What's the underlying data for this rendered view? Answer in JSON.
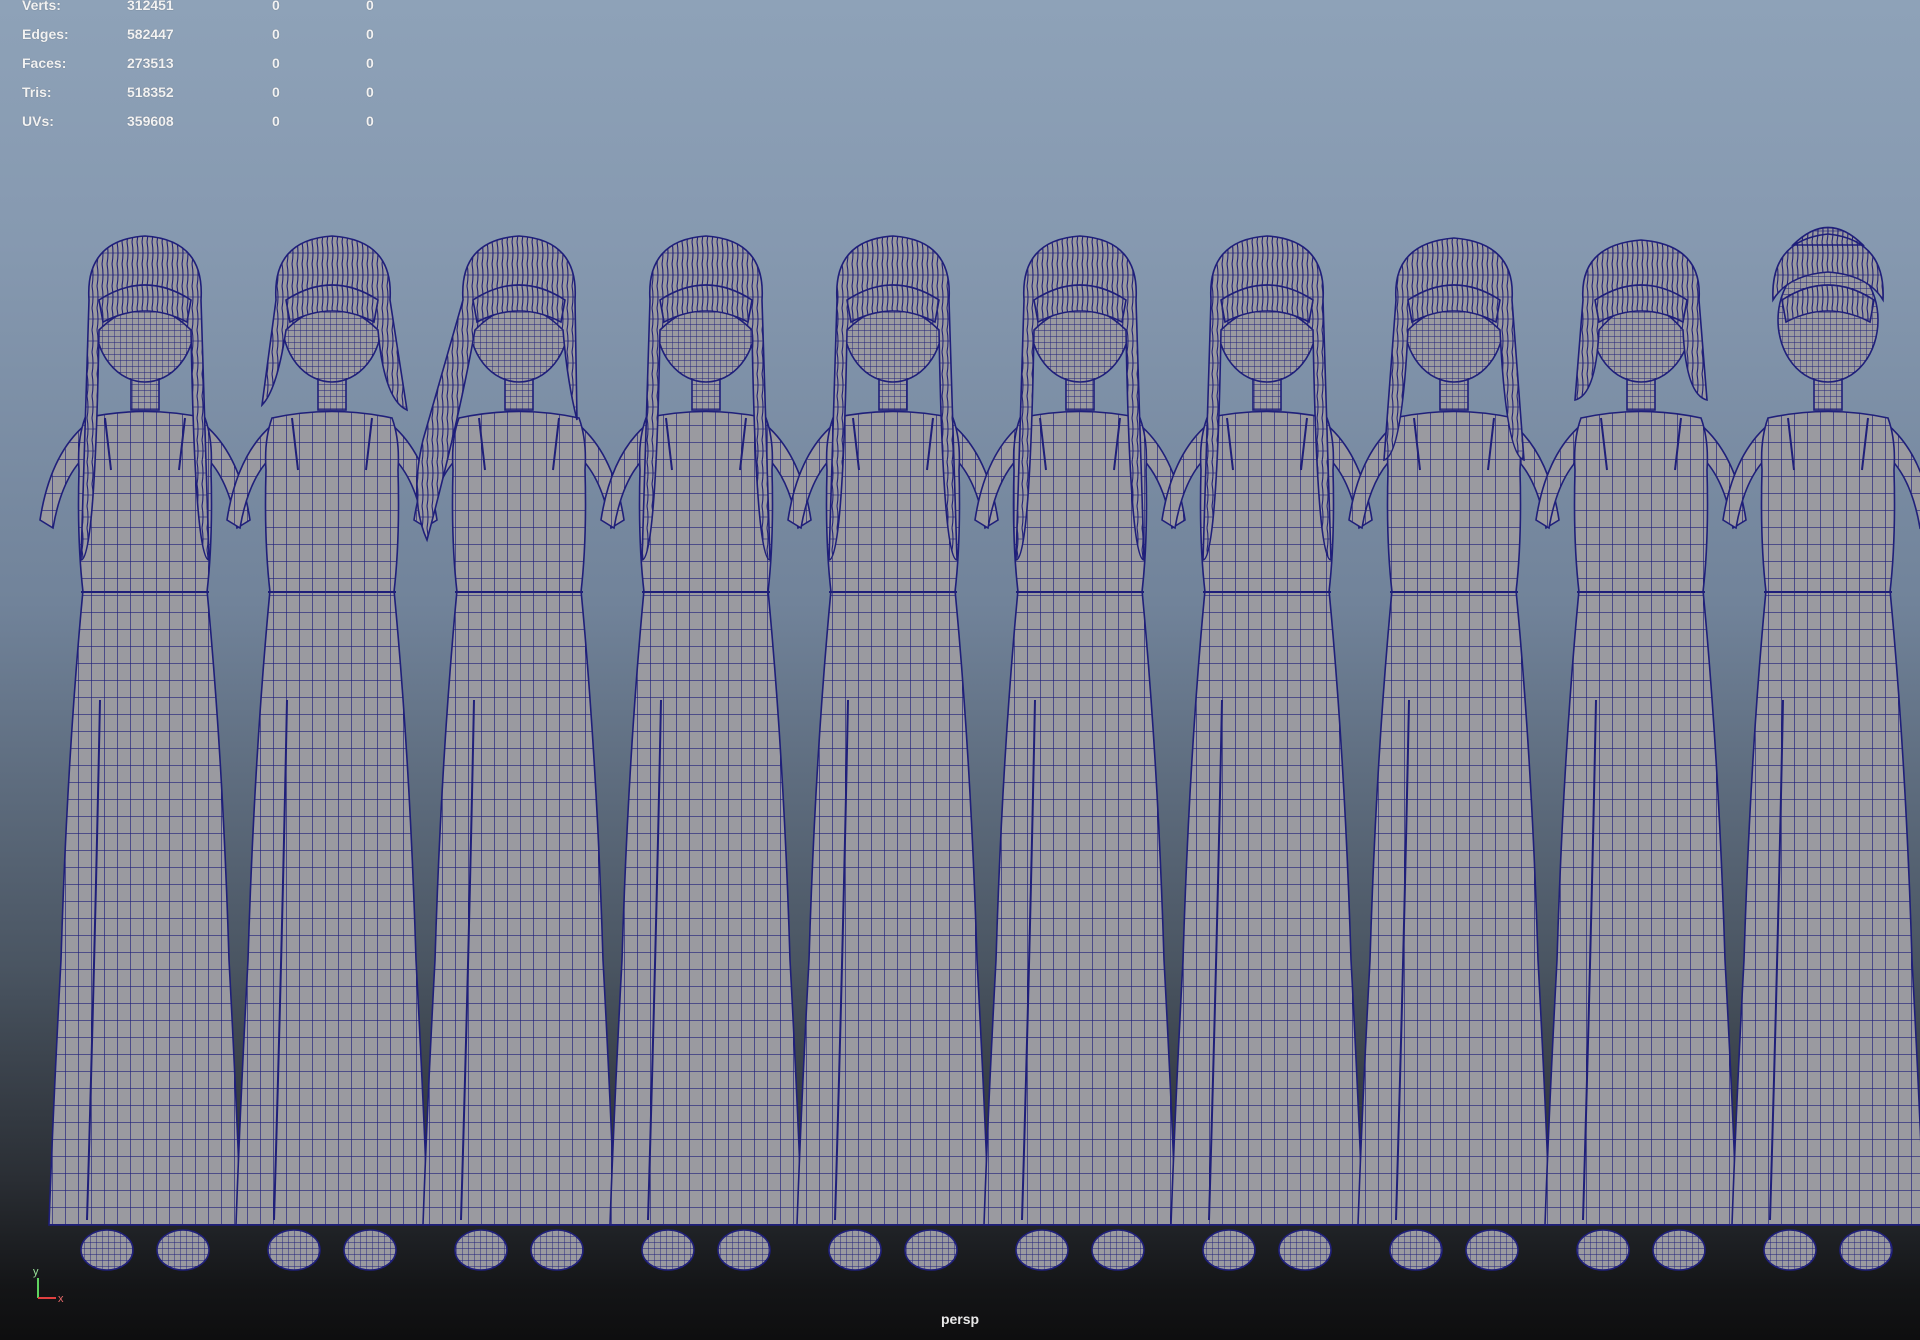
{
  "hud": {
    "rows": [
      {
        "label": "Verts:",
        "v1": "312451",
        "v2": "0",
        "v3": "0"
      },
      {
        "label": "Edges:",
        "v1": "582447",
        "v2": "0",
        "v3": "0"
      },
      {
        "label": "Faces:",
        "v1": "273513",
        "v2": "0",
        "v3": "0"
      },
      {
        "label": "Tris:",
        "v1": "518352",
        "v2": "0",
        "v3": "0"
      },
      {
        "label": "UVs:",
        "v1": "359608",
        "v2": "0",
        "v3": "0"
      }
    ]
  },
  "viewport": {
    "camera": "persp",
    "wire_color": "#1f1f7a",
    "shade_color": "#9a9aa0",
    "axis": {
      "y": "y",
      "x": "x"
    }
  },
  "scene": {
    "model_count": 10,
    "hair_styles": [
      "long-straight",
      "curly-side",
      "long-wavy",
      "long-straight",
      "long-bangs",
      "braids",
      "braids",
      "bob-bangs",
      "short-bob",
      "updo"
    ]
  }
}
